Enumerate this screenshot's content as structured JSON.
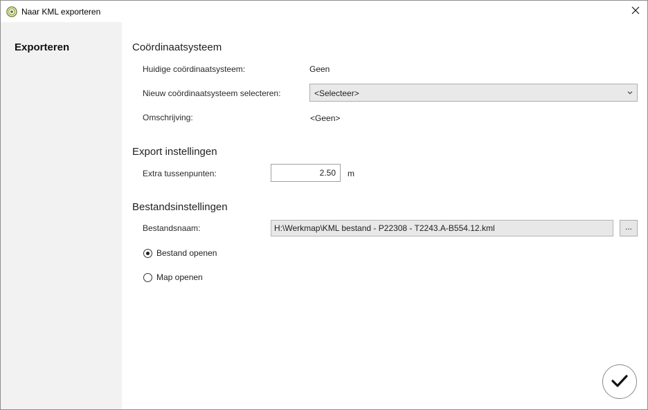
{
  "window": {
    "title": "Naar KML exporteren"
  },
  "sidebar": {
    "items": [
      {
        "label": "Exporteren"
      }
    ]
  },
  "coordinate_system": {
    "heading": "Coördinaatsysteem",
    "current_label": "Huidige coördinaatsysteem:",
    "current_value": "Geen",
    "new_label": "Nieuw coördinaatsysteem selecteren:",
    "new_value": "<Selecteer>",
    "description_label": "Omschrijving:",
    "description_value": "<Geen>"
  },
  "export_settings": {
    "heading": "Export instellingen",
    "extra_points_label": "Extra tussenpunten:",
    "extra_points_value": "2.50",
    "extra_points_unit": "m"
  },
  "file_settings": {
    "heading": "Bestandsinstellingen",
    "filename_label": "Bestandsnaam:",
    "filename_value": "H:\\Werkmap\\KML bestand - P22308 - T2243.A-B554.12.kml",
    "browse_label": "...",
    "options": [
      {
        "label": "Bestand openen",
        "checked": true
      },
      {
        "label": "Map openen",
        "checked": false
      }
    ]
  },
  "icons": {
    "app": "kml-app-icon",
    "close": "close-icon",
    "dropdown": "chevron-down-icon",
    "confirm": "checkmark-icon"
  }
}
